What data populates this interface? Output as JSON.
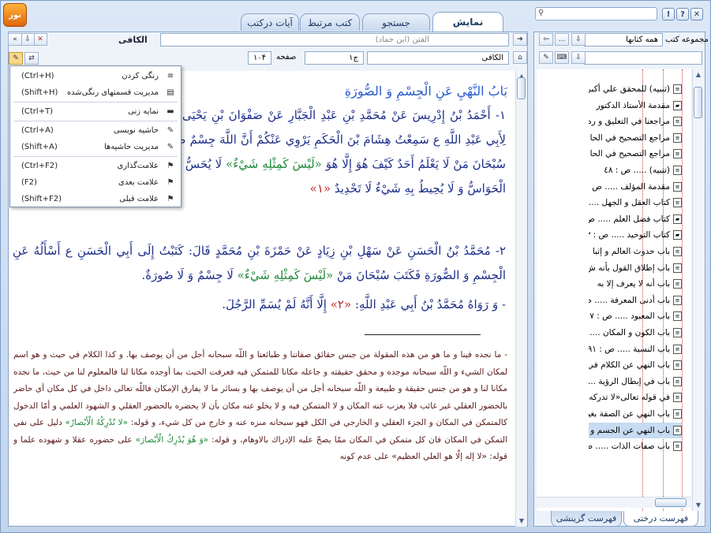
{
  "app": {
    "logo_text": "نور"
  },
  "window_buttons": {
    "close": "✕",
    "help": "?",
    "info": "!"
  },
  "tabs": [
    {
      "label": "نمایش",
      "active": true
    },
    {
      "label": "جستجو",
      "active": false
    },
    {
      "label": "کتب مرتبط",
      "active": false
    },
    {
      "label": "آیات درکتب",
      "active": false
    }
  ],
  "left_header": {
    "collection_label": "مجموعه کتب",
    "collection_value": "همه کتابها",
    "more": "..."
  },
  "reader_header": {
    "book_title": "الکافی",
    "subtitle": "الفتن (ابن حماد)",
    "book_field": "الکافی",
    "volume_field": "ج۱",
    "page_label": "صفحه",
    "page_value": "۱۰۴"
  },
  "menu": {
    "items": [
      {
        "label": "رنگی کردن",
        "shortcut": "(Ctrl+H)",
        "icon": "≡"
      },
      {
        "label": "مدیریت قسمتهای رنگی‌شده",
        "shortcut": "(Shift+H)",
        "icon": "▤"
      },
      {
        "label": "نمایه زنی",
        "shortcut": "(Ctrl+T)",
        "icon": "▬"
      },
      {
        "label": "حاشیه نویسی",
        "shortcut": "(Ctrl+A)",
        "icon": "✎"
      },
      {
        "label": "مدیریت حاشیه‌ها",
        "shortcut": "(Shift+A)",
        "icon": "✎"
      },
      {
        "label": "علامت‌گذاری",
        "shortcut": "(Ctrl+F2)",
        "icon": "⚑"
      },
      {
        "label": "علامت بعدی",
        "shortcut": "(F2)",
        "icon": "⚑"
      },
      {
        "label": "علامت قبلی",
        "shortcut": "(Shift+F2)",
        "icon": "⚑"
      }
    ]
  },
  "content": {
    "title": "بَابُ النَّهْيِ عَنِ الْجِسْمِ وَ الصُّورَةِ",
    "para1": [
      {
        "t": "١- أَحْمَدُ بْنُ إِدْرِيسَ عَنْ مُحَمَّدِ بْنِ عَبْدِ الْجَبَّارِ عَنْ صَفْوَانَ بْنِ يَحْيَى عَنْ عَلِيِّ بْنِ أَبِي حَمْزَةَ قَالَ: قُلْتُ لِأَبِي عَبْدِ",
        "c": ""
      },
      {
        "t": "اللَّهِ ع سَمِعْتُ هِشَامَ بْنَ الْحَكَمِ يَرْوِي عَنْكُمْ أَنَّ اللَّهَ جِسْمٌ صَمَدِيٌّ نُورِيٌّ",
        "c": ""
      },
      {
        "t": "يَشَاءُ مِنْ خَلْقِهِ فَقَالَ ع سُبْحَانَ مَنْ لَا يَعْلَمُ أَحَدٌ كَيْفَ هُوَ إِلَّا هُوَ ",
        "c": ""
      },
      {
        "t": "«لَيْسَ كَمِثْلِهِ شَيْءٌ»",
        "c": "g"
      },
      {
        "t": "لَا يُحَسُّ وَ لَا يُجَسُّ وَ ",
        "c": ""
      },
      {
        "t": "«لا تُدْرِكُهُ الْأَبْصارُ»",
        "c": "g"
      },
      {
        "t": " وَ لَا الْحَوَاسُّ وَ لَا يُحِيطُ بِهِ شَيْءٌ",
        "c": ""
      },
      {
        "t": "لَا تَحْدِيدٌ ",
        "c": ""
      },
      {
        "t": "«١»",
        "c": "r"
      }
    ],
    "para2": [
      {
        "t": "٢- مُحَمَّدُ بْنُ الْحَسَنِ عَنْ سَهْلِ بْنِ زِيَادٍ عَنْ حَمْزَةَ بْنِ مُحَمَّدٍ قَالَ: كَتَبْتُ إِلَى أَبِي الْحَسَنِ ع أَسْأَلُهُ عَنِ الْجِسْمِ وَ",
        "c": ""
      },
      {
        "t": "الصُّورَةِ فَكَتَبَ سُبْحَانَ مَنْ ",
        "c": ""
      },
      {
        "t": "«لَيْسَ كَمِثْلِهِ شَيْءٌ»",
        "c": "g"
      },
      {
        "t": " لَا جِسْمٌ وَ لَا صُورَةٌ.",
        "c": ""
      }
    ],
    "para3": [
      {
        "t": "- وَ رَوَاهُ مُحَمَّدُ بْنُ أَبِي عَبْدِ اللَّهِ: ",
        "c": ""
      },
      {
        "t": "«٢»",
        "c": "r"
      },
      {
        "t": " إِلَّا أَنَّهُ لَمْ يُسَمِّ الرَّجُلَ.",
        "c": ""
      }
    ],
    "commentary": [
      {
        "t": "- ما نجده فينا و ما هو من هذه المقولة من جنس حقائق صفاتنا و طبائعنا و اللّه سبحانه أجل من أن يوصف بها. و كذا الكلام في حيث و هو اسم لمكان الشي‏ء و اللّه سبحانه موجده و محقق حقيقته و جاعله مكانا للمتمكن فيه فعرفت الحيث بما أوجده مكانا لنا فالمعلوم لنا من حيث، ما نجده مكانا لنا و هو من جنس حقيقة و طبيعة و اللّه سبحانه أجل من أن يوصف بها و بسائر ما لا يفارق الإمكان فاللّه تعالى داخل في كل مكان أي حاضر بالحضور العقلي غير غائب فلا يعزب عنه المكان و لا المتمكن فيه و لا يخلو عنه مكان بأن لا يحضره بالحضور العقلي و الشهود العلمي و أمّا الدخول كالمتمكن في المكان و الجزء العقلي و الخارجي في الكل فهو سبحانه منزه عنه و خارج من كل شي‏ء، و قوله: ",
        "c": ""
      },
      {
        "t": "«لا تُدْرِكُهُ الْأَبْصارُ»",
        "c": "g"
      },
      {
        "t": " دليل على نفي التمكن في المكان فان كل متمكن في المكان ممّا يصحّ عليه الإدراك بالاوهام، و قوله: ",
        "c": ""
      },
      {
        "t": "«وَ هُوَ يُدْرِكُ الْأَبْصارَ»",
        "c": "g"
      },
      {
        "t": " على حضوره عقلا و شهوده علما و قوله: «لا إله إلّا هو العلي العظيم» على عدم كونه",
        "c": ""
      }
    ]
  },
  "tree": {
    "items": [
      {
        "label": "(تنبيه) للمحقق علي أكبر",
        "icon": "page",
        "selected": false
      },
      {
        "label": "مقدمة الأستاذ الدكتور",
        "icon": "book",
        "selected": false
      },
      {
        "label": "مراجعنا في التعليق و ره",
        "icon": "page",
        "selected": false
      },
      {
        "label": "مراجع التصحيح في الحا",
        "icon": "page",
        "selected": false
      },
      {
        "label": "مراجع التصحيح في الحا",
        "icon": "page",
        "selected": false
      },
      {
        "label": "(تنبيه) ..... ص : ٤٨",
        "icon": "page",
        "selected": false
      },
      {
        "label": "مقدمة المؤلف ..... ص : ٢",
        "icon": "page",
        "selected": false
      },
      {
        "label": "كتاب العقل و الجهل ..... حو",
        "icon": "page",
        "selected": false
      },
      {
        "label": "كتاب فضل العلم ..... ص :",
        "icon": "book",
        "selected": false
      },
      {
        "label": "كتاب التوحيد ..... ص : ٧٣",
        "icon": "book",
        "selected": false
      },
      {
        "label": "باب حدوث العالم و إثبا",
        "icon": "page",
        "selected": false
      },
      {
        "label": "باب إطلاق القول بأنه ش",
        "icon": "page",
        "selected": false
      },
      {
        "label": "باب أنه لا يعرف إلا به",
        "icon": "page",
        "selected": false
      },
      {
        "label": "باب أدنى المعرفة ..... ص",
        "icon": "page",
        "selected": false
      },
      {
        "label": "باب المعبود ..... ص : ٧",
        "icon": "page",
        "selected": false
      },
      {
        "label": "باب الكون و المكان .....",
        "icon": "page",
        "selected": false
      },
      {
        "label": "باب النسبة ..... ص : ٩١",
        "icon": "page",
        "selected": false
      },
      {
        "label": "باب النهي عن الكلام في",
        "icon": "page",
        "selected": false
      },
      {
        "label": "باب في إبطال الرؤية .....",
        "icon": "page",
        "selected": false
      },
      {
        "label": "في قوله تعالى«لا تدركه",
        "icon": "page",
        "selected": false
      },
      {
        "label": "باب النهي عن الصفة بغير",
        "icon": "page",
        "selected": false
      },
      {
        "label": "باب النهي عن الجسم و",
        "icon": "page",
        "selected": true
      },
      {
        "label": "باب صفات الذات ..... ص",
        "icon": "page",
        "selected": false
      }
    ]
  },
  "bottom_tabs": [
    {
      "label": "فهرست درختی",
      "active": true
    },
    {
      "label": "فهرست گزینشی",
      "active": false
    }
  ],
  "colors": {
    "accent": "#c0282a",
    "green": "#1f8a3b",
    "blue": "#1e2f8a"
  }
}
